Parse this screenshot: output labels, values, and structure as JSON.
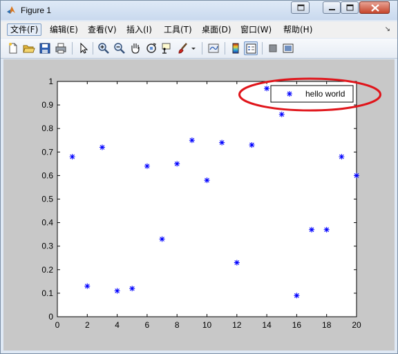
{
  "window": {
    "title": "Figure 1",
    "buttons": [
      "restore-extra",
      "minimize",
      "maximize",
      "close"
    ]
  },
  "menu": {
    "items": [
      {
        "label": "文件(F)",
        "active": true
      },
      {
        "label": "编辑(E)",
        "active": false
      },
      {
        "label": "查看(V)",
        "active": false
      },
      {
        "label": "插入(I)",
        "active": false
      },
      {
        "label": "工具(T)",
        "active": false
      },
      {
        "label": "桌面(D)",
        "active": false
      },
      {
        "label": "窗口(W)",
        "active": false
      },
      {
        "label": "帮助(H)",
        "active": false
      }
    ],
    "overflow_arrow": "↘"
  },
  "toolbar": {
    "icons": [
      "new-figure-icon",
      "open-file-icon",
      "save-icon",
      "print-icon",
      "select-pointer-icon",
      "zoom-in-icon",
      "zoom-out-icon",
      "pan-hand-icon",
      "rotate-3d-icon",
      "data-cursor-icon",
      "brush-icon",
      "brush-dropdown-icon",
      "link-plot-icon",
      "colorbar-icon",
      "legend-icon",
      "hide-plot-tools-icon",
      "show-plot-tools-icon"
    ]
  },
  "colors": {
    "marker": "#0000ff",
    "figure_bg": "#c8c8c8",
    "axes_bg": "#ffffff",
    "annotation": "#e0151b"
  },
  "chart_data": {
    "type": "scatter",
    "marker": "*",
    "series": [
      {
        "name": "hello world",
        "x": [
          1,
          2,
          3,
          4,
          5,
          6,
          7,
          8,
          9,
          10,
          11,
          12,
          13,
          14,
          15,
          16,
          17,
          18,
          19,
          20
        ],
        "y": [
          0.68,
          0.13,
          0.72,
          0.11,
          0.12,
          0.64,
          0.33,
          0.65,
          0.75,
          0.58,
          0.74,
          0.23,
          0.73,
          0.97,
          0.86,
          0.09,
          0.37,
          0.37,
          0.68,
          0.6
        ]
      }
    ],
    "xlim": [
      0,
      20
    ],
    "ylim": [
      0,
      1
    ],
    "xticks": [
      0,
      2,
      4,
      6,
      8,
      10,
      12,
      14,
      16,
      18,
      20
    ],
    "yticks": [
      0,
      0.1,
      0.2,
      0.3,
      0.4,
      0.5,
      0.6,
      0.7,
      0.8,
      0.9,
      1
    ],
    "xtick_labels": [
      "0",
      "2",
      "4",
      "6",
      "8",
      "10",
      "12",
      "14",
      "16",
      "18",
      "20"
    ],
    "ytick_labels": [
      "0",
      "0.1",
      "0.2",
      "0.3",
      "0.4",
      "0.5",
      "0.6",
      "0.7",
      "0.8",
      "0.9",
      "1"
    ],
    "legend": {
      "entries": [
        "hello world"
      ],
      "placement": "top-right"
    },
    "grid": false,
    "annotation": "red ellipse around legend"
  }
}
